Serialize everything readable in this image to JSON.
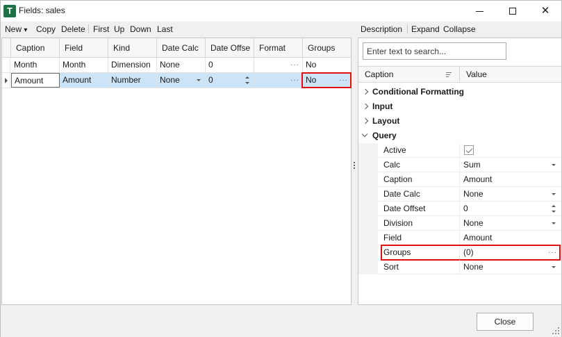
{
  "window": {
    "icon_letter": "T",
    "title": "Fields: sales",
    "minimize_icon": "minimize-icon",
    "maximize_icon": "maximize-icon",
    "close_glyph": "✕"
  },
  "left_toolbar": {
    "new_label": "New",
    "new_arrow": "▾",
    "copy_label": "Copy",
    "delete_label": "Delete",
    "first_label": "First",
    "up_label": "Up",
    "down_label": "Down",
    "last_label": "Last"
  },
  "grid": {
    "columns": [
      "Caption",
      "Field",
      "Kind",
      "Date Calc",
      "Date Offse",
      "Format",
      "Groups"
    ],
    "rows": [
      {
        "caption": "Month",
        "field": "Month",
        "kind": "Dimension",
        "date_calc": "None",
        "date_offset": "0",
        "format": "",
        "groups": "No"
      },
      {
        "caption": "Amount",
        "field": "Amount",
        "kind": "Number",
        "date_calc": "None",
        "date_offset": "0",
        "format": "",
        "groups": "No"
      }
    ],
    "ellipsis": "···"
  },
  "right_toolbar": {
    "description_label": "Description",
    "expand_label": "Expand",
    "collapse_label": "Collapse"
  },
  "properties": {
    "search_placeholder": "Enter text to search...",
    "header_caption": "Caption",
    "header_value": "Value",
    "categories": {
      "conditional_formatting": "Conditional Formatting",
      "input": "Input",
      "layout": "Layout",
      "query": "Query"
    },
    "items": [
      {
        "label": "Active",
        "value": "",
        "control": "checkbox",
        "checked": true
      },
      {
        "label": "Calc",
        "value": "Sum",
        "control": "dropdown"
      },
      {
        "label": "Caption",
        "value": "Amount",
        "control": "text"
      },
      {
        "label": "Date Calc",
        "value": "None",
        "control": "dropdown"
      },
      {
        "label": "Date Offset",
        "value": "0",
        "control": "spin"
      },
      {
        "label": "Division",
        "value": "None",
        "control": "dropdown"
      },
      {
        "label": "Field",
        "value": "Amount",
        "control": "text"
      },
      {
        "label": "Groups",
        "value": "(0)",
        "control": "ellipsis"
      },
      {
        "label": "Sort",
        "value": "None",
        "control": "dropdown"
      }
    ],
    "ellipsis": "···"
  },
  "footer": {
    "close_label": "Close"
  },
  "colors": {
    "selected_row": "#cce4f7",
    "highlight_border": "#e01010",
    "app_icon": "#1e7145"
  }
}
